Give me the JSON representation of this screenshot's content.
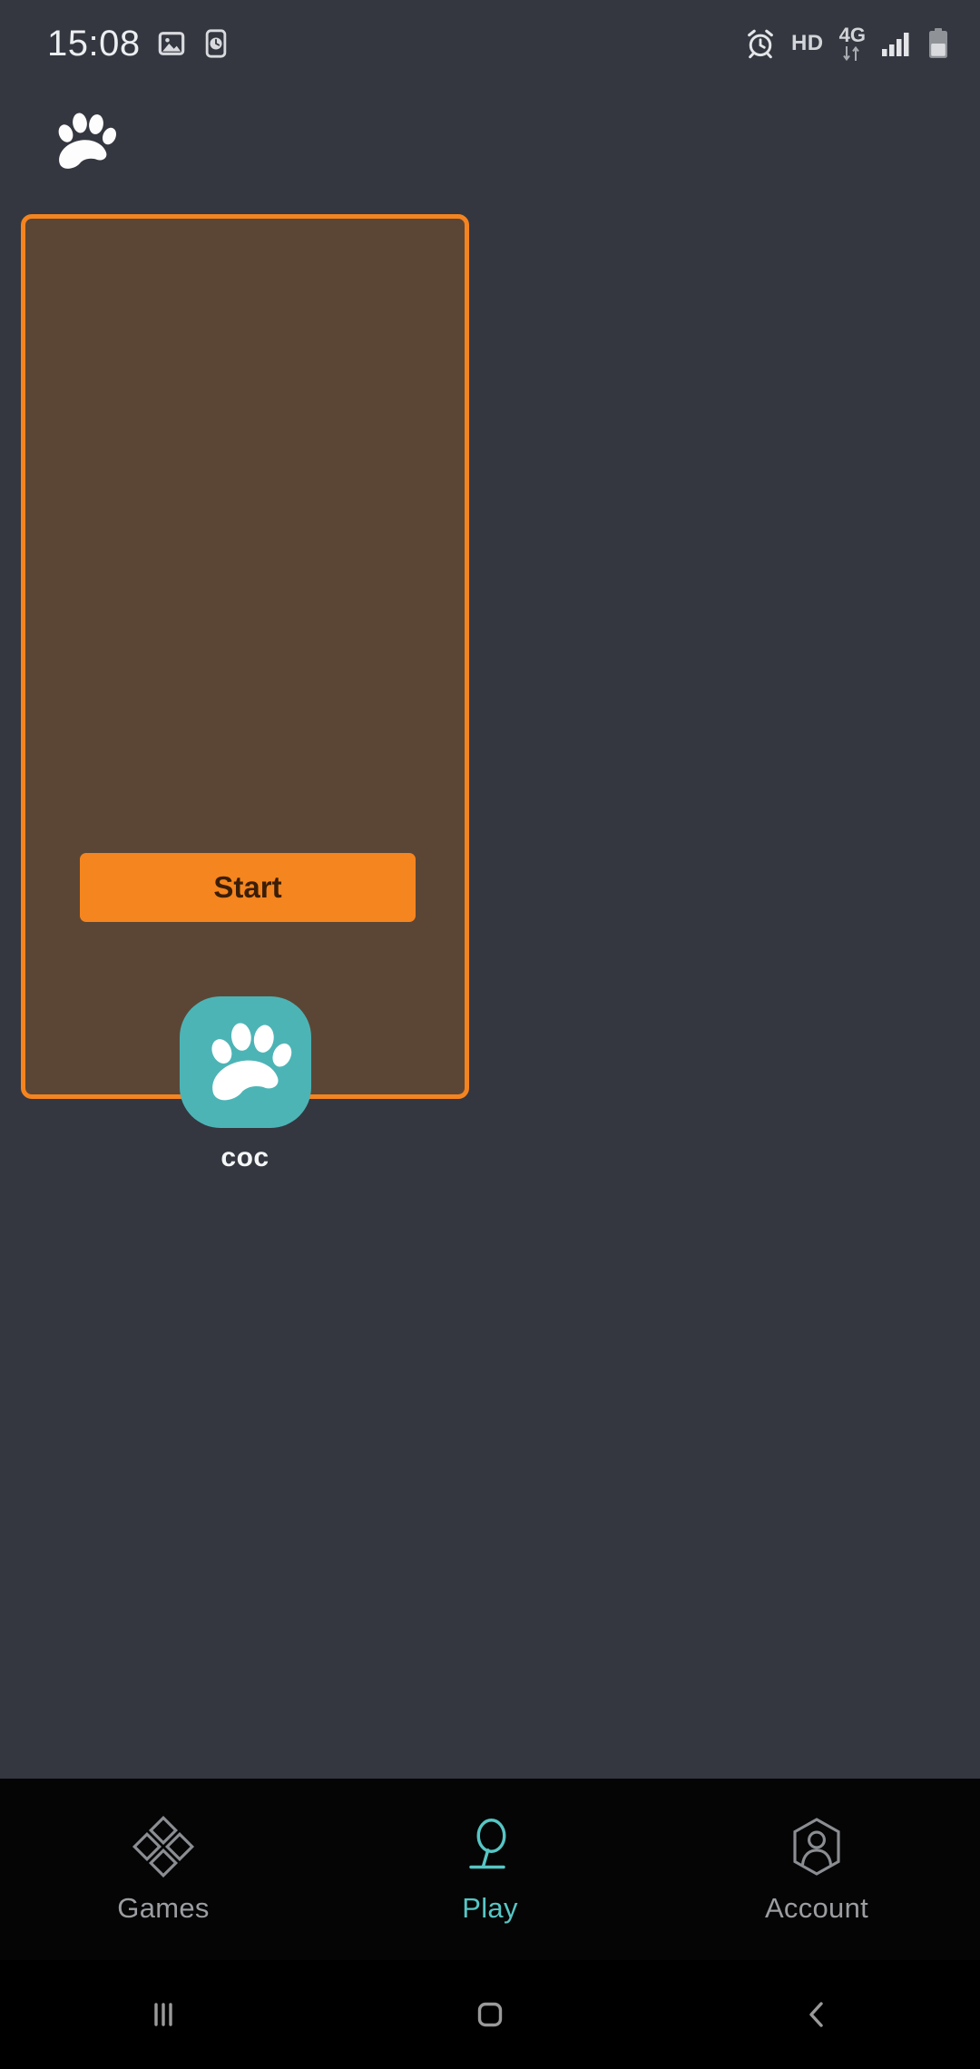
{
  "status_bar": {
    "clock": "15:08",
    "left_icons": [
      "photo-icon",
      "clock-app-icon"
    ],
    "right_icons": [
      "alarm-icon",
      "signal-icon",
      "battery-icon"
    ],
    "hd_label": "HD",
    "network_generation": "4G",
    "signal_bars": 4,
    "battery_level_pct": 45
  },
  "header": {
    "logo_icon": "paw-logo-icon"
  },
  "game_panel": {
    "start_label": "Start",
    "border_color": "#f5841f",
    "background_color": "#5b4636"
  },
  "app_shortcut": {
    "label": "coc",
    "icon": "paw-app-icon",
    "icon_color": "#4db4b6"
  },
  "tab_bar": {
    "active_color": "#56c6c5",
    "inactive_color": "#9b9da1",
    "items": [
      {
        "label": "Games",
        "icon": "diamonds-icon",
        "active": false
      },
      {
        "label": "Play",
        "icon": "trophy-icon",
        "active": true
      },
      {
        "label": "Account",
        "icon": "person-hexagon-icon",
        "active": false
      }
    ]
  },
  "system_nav": {
    "buttons": [
      {
        "name": "recents-button",
        "icon": "three-bars-icon"
      },
      {
        "name": "home-button",
        "icon": "rounded-square-icon"
      },
      {
        "name": "back-button",
        "icon": "chevron-left-icon"
      }
    ]
  }
}
